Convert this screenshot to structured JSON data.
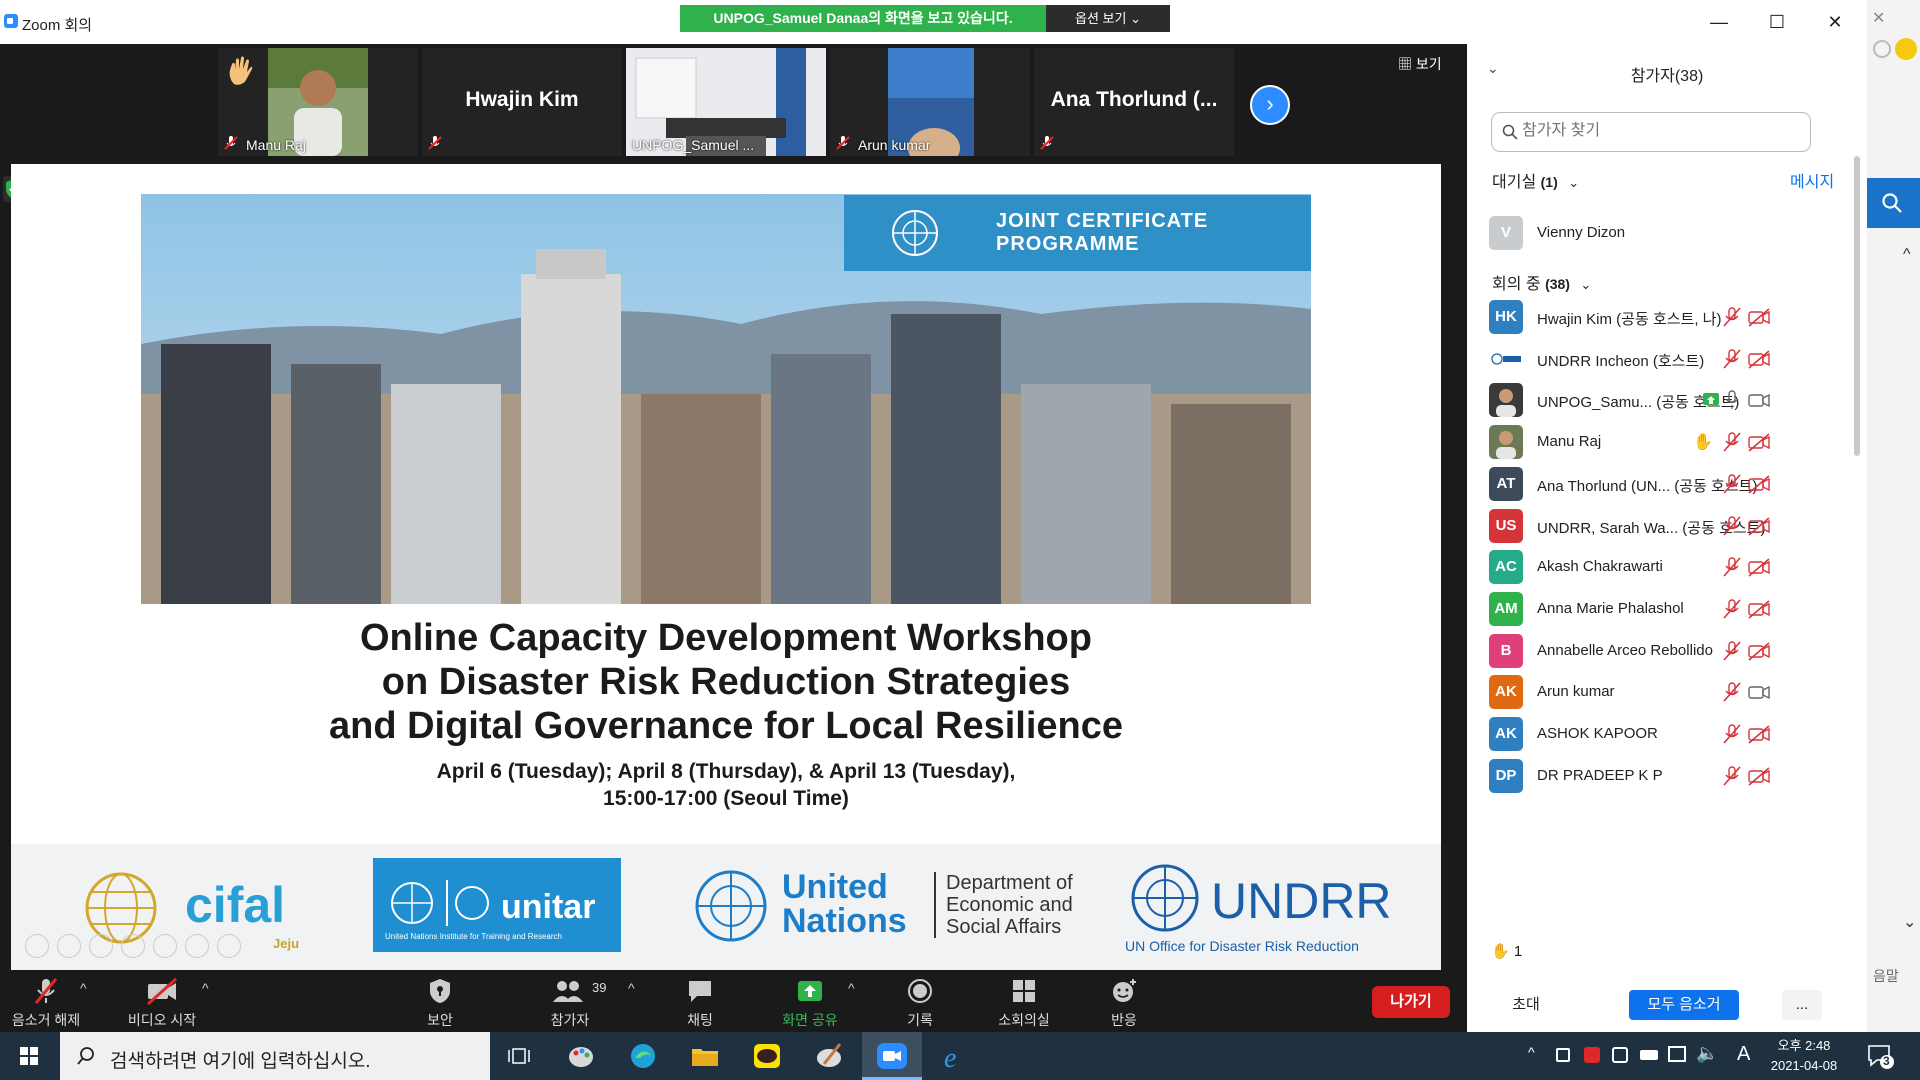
{
  "window": {
    "title": "Zoom 회의",
    "share_banner": "UNPOG_Samuel  Danaa의 화면을 보고 있습니다.",
    "view_options": "옵션 보기 ⌄",
    "minimize": "—",
    "maximize": "☐",
    "close": "✕"
  },
  "video_strip": {
    "view_label": "보기",
    "tiles": [
      {
        "name": "Manu Raj"
      },
      {
        "name": "Hwajin Kim"
      },
      {
        "name": "UNPOG_Samuel ..."
      },
      {
        "name": "Arun kumar"
      },
      {
        "name": "Ana Thorlund (..."
      }
    ]
  },
  "slide": {
    "banner_text_1": "JOINT CERTIFICATE",
    "banner_text_2": "PROGRAMME",
    "title_lines": [
      "Online Capacity Development Workshop",
      "on Disaster Risk Reduction Strategies",
      "and Digital Governance for Local Resilience"
    ],
    "dates_line_1": "April 6 (Tuesday); April 8 (Thursday), & April 13 (Tuesday),",
    "dates_line_2": "15:00-17:00 (Seoul Time)",
    "logos": {
      "cifal": "cifal",
      "cifal_sub": "Jeju",
      "unitar": "unitar",
      "unitar_sub": "United Nations Institute for Training and Research",
      "un_line_1": "United",
      "un_line_2": "Nations",
      "desa_1": "Department of",
      "desa_2": "Economic and",
      "desa_3": "Social Affairs",
      "undrr": "UNDRR",
      "undrr_sub": "UN Office for Disaster Risk Reduction"
    }
  },
  "panel": {
    "title": "참가자(38)",
    "search_placeholder": "참가자 찾기",
    "waiting_label": "대기실",
    "waiting_count": "(1)",
    "message_link": "메시지",
    "waiting": [
      {
        "initial": "V",
        "name": "Vienny Dizon",
        "color": "#c9ccce"
      }
    ],
    "in_meeting_label": "회의 중",
    "in_meeting_count": "(38)",
    "participants": [
      {
        "initials": "HK",
        "name": "Hwajin Kim (공동 호스트, 나)",
        "color": "#2f7fc1",
        "video": "off"
      },
      {
        "initials": "",
        "name": "UNDRR Incheon (호스트)",
        "color": "#ffffff",
        "video": "off"
      },
      {
        "initials": "",
        "name": "UNPOG_Samu... (공동 호스트)",
        "color": "#3a3a3a",
        "video": "on",
        "sharing": true
      },
      {
        "initials": "",
        "name": "Manu Raj",
        "color": "#6b7a55",
        "video": "off",
        "hand": true
      },
      {
        "initials": "AT",
        "name": "Ana Thorlund (UN...  (공동 호스트)",
        "color": "#3d4a5c",
        "video": "off"
      },
      {
        "initials": "US",
        "name": "UNDRR, Sarah Wa...  (공동 호스트)",
        "color": "#d6343b",
        "video": "off"
      },
      {
        "initials": "AC",
        "name": "Akash Chakrawarti",
        "color": "#26ab8a",
        "video": "off"
      },
      {
        "initials": "AM",
        "name": "Anna Marie Phalashol",
        "color": "#2fb24c",
        "video": "off"
      },
      {
        "initials": "B",
        "name": "Annabelle Arceo Rebollido",
        "color": "#e0407a",
        "video": "off"
      },
      {
        "initials": "AK",
        "name": "Arun kumar",
        "color": "#e06a13",
        "video": "on"
      },
      {
        "initials": "AK",
        "name": "ASHOK KAPOOR",
        "color": "#2f7fc1",
        "video": "off"
      },
      {
        "initials": "DP",
        "name": "DR PRADEEP K P",
        "color": "#2f7fc1",
        "video": "off"
      }
    ],
    "raised_hands": "1",
    "invite_button": "초대",
    "mute_all_button": "모두 음소거",
    "more_button": "..."
  },
  "toolbar": {
    "unmute": "음소거 해제",
    "start_video": "비디오 시작",
    "security": "보안",
    "participants": "참가자",
    "participants_count": "39",
    "chat": "채팅",
    "share_screen": "화면 공유",
    "record": "기록",
    "breakout": "소회의실",
    "reactions": "반응",
    "leave": "나가기"
  },
  "taskbar": {
    "search_text": "검색하려면 여기에 입력하십시오.",
    "time": "오후 2:48",
    "date": "2021-04-08",
    "ime": "A",
    "notifications": "3"
  },
  "bg_window": {
    "partial_text": "음말"
  },
  "colors": {
    "zoom_blue": "#2d8cff",
    "share_green": "#2fb24c",
    "leave_red": "#d71e1e",
    "mute_red": "#d6343b"
  }
}
